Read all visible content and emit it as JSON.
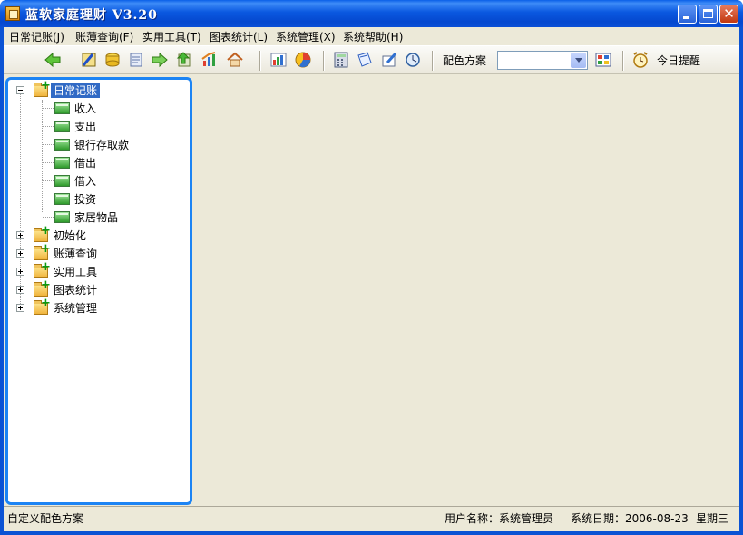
{
  "window": {
    "title": "蓝软家庭理财 V3.20"
  },
  "menu": [
    {
      "label": "日常记账(J)"
    },
    {
      "label": "账薄查询(F)"
    },
    {
      "label": "实用工具(T)"
    },
    {
      "label": "图表统计(L)"
    },
    {
      "label": "系统管理(X)"
    },
    {
      "label": "系统帮助(H)"
    }
  ],
  "toolbar": {
    "color_scheme_label": "配色方案",
    "color_scheme_value": "",
    "today_reminder_label": "今日提醒"
  },
  "tree": {
    "root_expanded": {
      "label": "日常记账",
      "children": [
        "收入",
        "支出",
        "银行存取款",
        "借出",
        "借入",
        "投资",
        "家居物品"
      ]
    },
    "collapsed": [
      "初始化",
      "账薄查询",
      "实用工具",
      "图表统计",
      "系统管理"
    ]
  },
  "status": {
    "left": "自定义配色方案",
    "user": "用户名称：系统管理员",
    "date": "系统日期：2006-08-23",
    "weekday": "星期三"
  },
  "colors": {
    "titlebar": "#0a58e0",
    "tree_border": "#1c84f4",
    "selection": "#316ac5",
    "background": "#ece9d8"
  }
}
